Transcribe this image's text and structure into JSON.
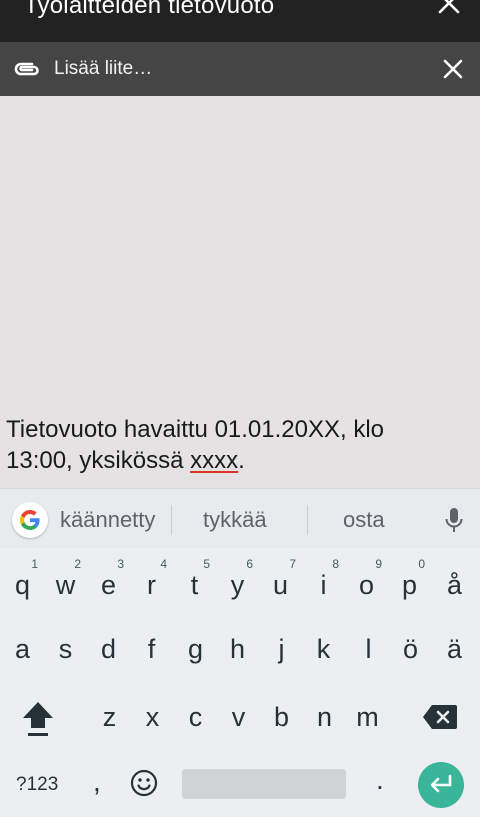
{
  "titlebar": {
    "title": "Työlaitteiden tietovuoto"
  },
  "attachbar": {
    "label": "Lisää liite…"
  },
  "message": {
    "text_line1": "Tietovuoto havaittu 01.01.20XX, klo",
    "text_line2_prefix": "13:00, yksikössä ",
    "text_line2_typo": "xxxx",
    "text_line2_suffix": "."
  },
  "keyboard": {
    "suggestions": [
      "käännetty",
      "tykkää",
      "osta"
    ],
    "row1": [
      {
        "key": "q",
        "hint": "1"
      },
      {
        "key": "w",
        "hint": "2"
      },
      {
        "key": "e",
        "hint": "3"
      },
      {
        "key": "r",
        "hint": "4"
      },
      {
        "key": "t",
        "hint": "5"
      },
      {
        "key": "y",
        "hint": "6"
      },
      {
        "key": "u",
        "hint": "7"
      },
      {
        "key": "i",
        "hint": "8"
      },
      {
        "key": "o",
        "hint": "9"
      },
      {
        "key": "p",
        "hint": "0"
      },
      {
        "key": "å",
        "hint": ""
      }
    ],
    "row2": [
      "a",
      "s",
      "d",
      "f",
      "g",
      "h",
      "j",
      "k",
      "l",
      "ö",
      "ä"
    ],
    "row3": [
      "z",
      "x",
      "c",
      "v",
      "b",
      "n",
      "m"
    ],
    "bottom": {
      "symbols": "?123",
      "comma": ",",
      "period": "."
    }
  },
  "colors": {
    "titlebar": "#222222",
    "attachbar": "#454545",
    "enter": "#3ab59a",
    "spellcheck": "#e0302a"
  }
}
